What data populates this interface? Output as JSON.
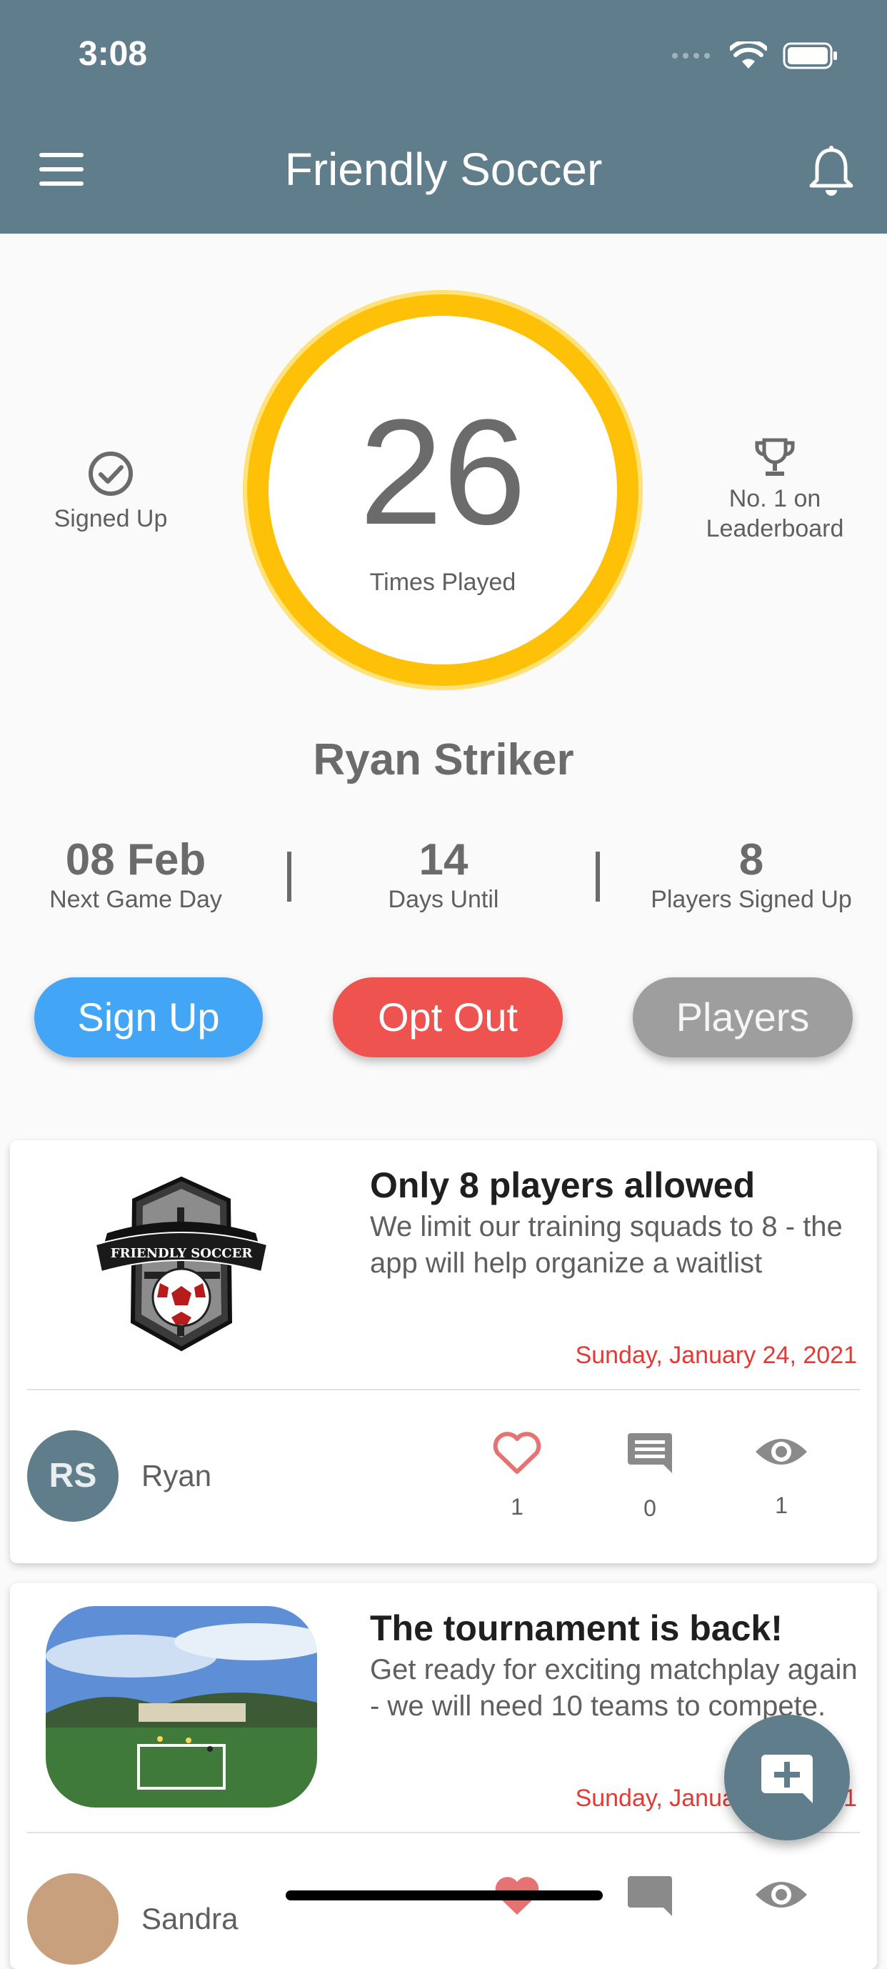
{
  "status_bar": {
    "time": "3:08"
  },
  "header": {
    "title": "Friendly Soccer"
  },
  "summary": {
    "signed_up_label": "Signed Up",
    "times_played": "26",
    "times_played_label": "Times Played",
    "leaderboard_line1": "No. 1 on",
    "leaderboard_line2": "Leaderboard",
    "player_name": "Ryan Striker"
  },
  "stats": [
    {
      "value": "08 Feb",
      "label": "Next Game Day"
    },
    {
      "value": "14",
      "label": "Days Until"
    },
    {
      "value": "8",
      "label": "Players Signed Up"
    }
  ],
  "buttons": {
    "sign_up": "Sign Up",
    "opt_out": "Opt Out",
    "players": "Players"
  },
  "posts": [
    {
      "title": "Only 8 players allowed",
      "body": "We limit our training squads to 8 - the app will help organize a waitlist",
      "date": "Sunday, January 24, 2021",
      "author_initials": "RS",
      "author": "Ryan",
      "likes": "1",
      "comments": "0",
      "views": "1",
      "logo_text": "FRIENDLY SOCCER"
    },
    {
      "title": "The tournament is back!",
      "body": "Get ready for exciting matchplay again - we will need 10 teams to compete.",
      "date": "Sunday, January 31, 2021",
      "author": "Sandra"
    }
  ],
  "colors": {
    "primary": "#607d8b",
    "ring": "#ffc107",
    "sign_up": "#42a5f5",
    "opt_out": "#ef5350",
    "players": "#9e9e9e",
    "date": "#e53935"
  },
  "icons": [
    "menu-icon",
    "bell-icon",
    "check-circle-icon",
    "trophy-icon",
    "heart-icon",
    "comment-icon",
    "eye-icon",
    "add-comment-icon"
  ]
}
